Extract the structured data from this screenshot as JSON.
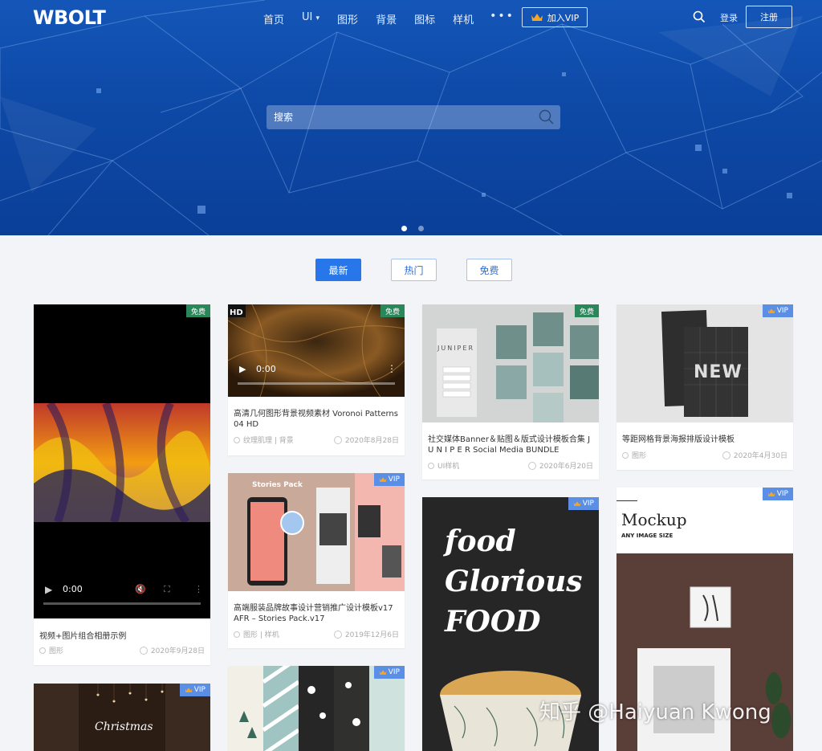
{
  "header": {
    "logo": "WBOLT",
    "nav": [
      {
        "label": "首页"
      },
      {
        "label": "UI"
      },
      {
        "label": "图形"
      },
      {
        "label": "背景"
      },
      {
        "label": "图标"
      },
      {
        "label": "样机"
      }
    ],
    "more": "•••",
    "vip_label": "加入VIP",
    "login": "登录",
    "register": "注册"
  },
  "search": {
    "placeholder": "搜索"
  },
  "carousel": {
    "slides": 2,
    "active": 1
  },
  "tabs": [
    {
      "label": "最新",
      "active": true
    },
    {
      "label": "热门",
      "active": false
    },
    {
      "label": "免费",
      "active": false
    }
  ],
  "cards": [
    {
      "title": "视频+图片组合相册示例",
      "category": "图形",
      "date": "2020年9月28日",
      "badge": "免费",
      "video_time": "0:00"
    },
    {
      "title": "高清几何图形背景视频素材 Voronoi Patterns 04 HD",
      "category": "纹理肌理 | 背景",
      "date": "2020年8月28日",
      "badge": "免费",
      "video_time": "0:00",
      "overlay_text": "HD"
    },
    {
      "title": "高端服装品牌故事设计营销推广设计模板v17 AFR – Stories Pack.v17",
      "category": "图形 | 样机",
      "date": "2019年12月6日",
      "badge": "VIP",
      "overlay_text": "Stories Pack"
    },
    {
      "title": "社交媒体Banner＆贴图＆版式设计模板合集 J U N I P E R Social Media BUNDLE",
      "category": "UI样机",
      "date": "2020年6月20日",
      "badge": "免费",
      "overlay_text": "JUNIPER"
    },
    {
      "title": "等距网格背景海报排版设计模板",
      "category": "图形",
      "date": "2020年4月30日",
      "badge": "VIP",
      "overlay_text": "NEW"
    },
    {
      "badge": "VIP",
      "overlay_text": "food Glorious FOOD"
    },
    {
      "badge": "VIP",
      "overlay_text": "Mockup",
      "overlay_sub": "ANY IMAGE SIZE"
    },
    {
      "badge": "VIP",
      "overlay_text": "Christmas"
    },
    {
      "badge": "VIP"
    }
  ],
  "watermark": "知乎 @Haiyuan Kwong",
  "colors": {
    "hero": "#0e4aa8",
    "accent": "#2776ea",
    "free_badge": "#29875a",
    "vip_badge": "#5b8fe6"
  }
}
